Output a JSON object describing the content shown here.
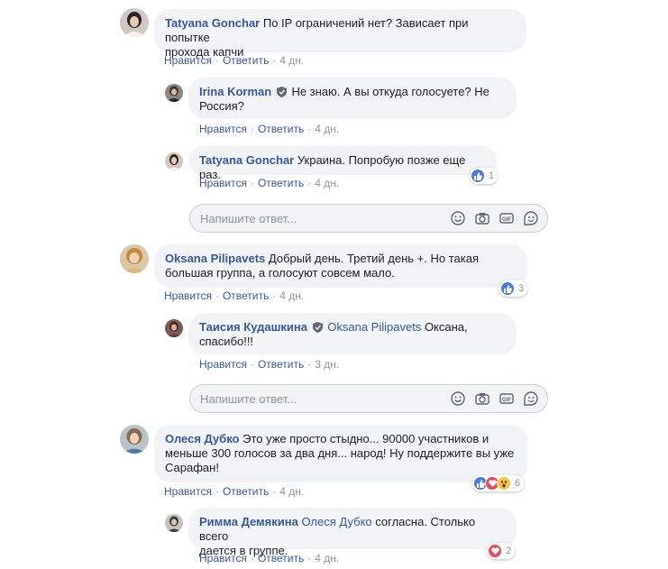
{
  "reply_input": {
    "placeholder": "Напишите ответ..."
  },
  "comments": [
    {
      "author": "Tatyana Gonchar",
      "text1": "По IP ограничений нет? Зависает при попытке",
      "text2": "прохода капчи",
      "like": "Нравится",
      "reply": "Ответить",
      "time": "4 дн."
    },
    {
      "author": "Irina Korman",
      "text1": "Не знаю. А вы откуда голосуете? Не",
      "text2": "Россия?",
      "like": "Нравится",
      "reply": "Ответить",
      "time": "4 дн."
    },
    {
      "author": "Tatyana Gonchar",
      "text1": "Украина. Попробую позже еще раз.",
      "like": "Нравится",
      "reply": "Ответить",
      "time": "4 дн.",
      "reactions": {
        "icons": [
          "like"
        ],
        "count": "1"
      }
    },
    {
      "author": "Oksana Pilipavets",
      "text1": "Добрый день. Третий день +. Но такая",
      "text2": "большая группа, а голосуют совсем мало.",
      "like": "Нравится",
      "reply": "Ответить",
      "time": "4 дн.",
      "reactions": {
        "icons": [
          "like"
        ],
        "count": "3"
      }
    },
    {
      "author": "Таисия Кудашкина",
      "mention": "Oksana Pilipavets",
      "text1": "Оксана,",
      "text2": "спасибо!!!",
      "like": "Нравится",
      "reply": "Ответить",
      "time": "3 дн."
    },
    {
      "author": "Олеся Дубко",
      "text1": "Это уже просто стыдно... 90000 участников и",
      "text2": "меньше 300 голосов за два дня... народ! Ну поддержите вы уже",
      "text3": "Сарафан!",
      "like": "Нравится",
      "reply": "Ответить",
      "time": "4 дн.",
      "reactions": {
        "icons": [
          "like",
          "love",
          "wow"
        ],
        "count": "6"
      }
    },
    {
      "author": "Римма Демякина",
      "mention": "Олеся Дубко",
      "text1": "согласна. Столько всего",
      "text2": "дается в группе.",
      "like": "Нравится",
      "reply": "Ответить",
      "time": "4 дн.",
      "reactions": {
        "icons": [
          "love"
        ],
        "count": "2"
      }
    }
  ]
}
